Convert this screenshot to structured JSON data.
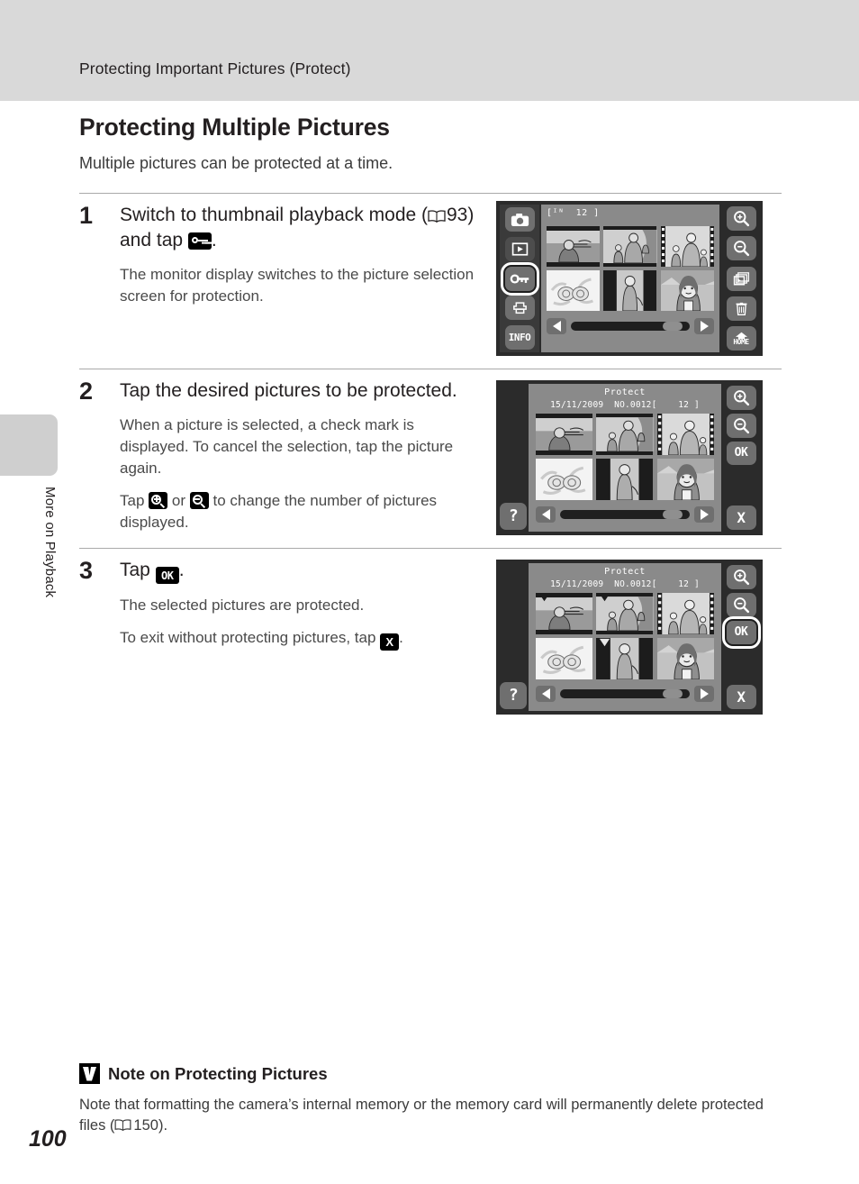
{
  "header": {
    "running_head": "Protecting Important Pictures (Protect)"
  },
  "sidebar": {
    "section_label": "More on Playback",
    "page_number": "100"
  },
  "section": {
    "title": "Protecting Multiple Pictures",
    "intro": "Multiple pictures can be protected at a time."
  },
  "steps": [
    {
      "number": "1",
      "head_part1": "Switch to thumbnail playback mode (",
      "head_ref": "93",
      "head_part2": ") and tap",
      "head_end": ".",
      "body": [
        "The monitor display switches to the picture selection screen for protection."
      ]
    },
    {
      "number": "2",
      "head": "Tap the desired pictures to be protected.",
      "body1": "When a picture is selected, a check mark is displayed. To cancel the selection, tap the picture again.",
      "body2_a": "Tap",
      "body2_b": "or",
      "body2_c": "to change the number of pictures displayed."
    },
    {
      "number": "3",
      "head_a": "Tap",
      "head_b": ".",
      "body1": "The selected pictures are protected.",
      "body2_a": "To exit without protecting pictures, tap",
      "body2_b": "."
    }
  ],
  "screens": {
    "screen1": {
      "counter": "[ᴵᴺ  12 ]",
      "left_buttons": [
        {
          "name": "camera-mode-button",
          "icon": "camera-icon",
          "selected": false
        },
        {
          "name": "playback-mode-button",
          "icon": "play-icon",
          "selected": false
        },
        {
          "name": "protect-button",
          "icon": "key-icon",
          "selected": true
        },
        {
          "name": "print-order-button",
          "icon": "printer-icon",
          "selected": false
        },
        {
          "name": "info-button",
          "icon": "info-icon",
          "label": "INFO",
          "selected": false
        }
      ],
      "right_buttons": [
        {
          "name": "zoom-in-button",
          "icon": "zoom-in-icon"
        },
        {
          "name": "zoom-out-button",
          "icon": "zoom-out-icon"
        },
        {
          "name": "slideshow-button",
          "icon": "frames-icon"
        },
        {
          "name": "delete-button",
          "icon": "trash-icon"
        },
        {
          "name": "home-button",
          "icon": "home-icon",
          "label": "HOME"
        }
      ],
      "scroll_left": "◀",
      "scroll_right": "▶"
    },
    "screen2": {
      "title": "Protect",
      "subline": "15/11/2009  NO.0012[    12 ]",
      "right_buttons": [
        {
          "name": "zoom-in-button",
          "icon": "zoom-in-icon"
        },
        {
          "name": "zoom-out-button",
          "icon": "zoom-out-icon"
        },
        {
          "name": "ok-button",
          "icon": "ok-icon",
          "label": "OK",
          "selected": false
        },
        {
          "name": "exit-button",
          "icon": "x-icon",
          "label": "X"
        }
      ],
      "help_button": "?",
      "checked": [
        false,
        false,
        false,
        false,
        false,
        false
      ]
    },
    "screen3": {
      "title": "Protect",
      "subline": "15/11/2009  NO.0012[    12 ]",
      "right_buttons": [
        {
          "name": "zoom-in-button",
          "icon": "zoom-in-icon"
        },
        {
          "name": "zoom-out-button",
          "icon": "zoom-out-icon"
        },
        {
          "name": "ok-button",
          "icon": "ok-icon",
          "label": "OK",
          "selected": true
        },
        {
          "name": "exit-button",
          "icon": "x-icon",
          "label": "X"
        }
      ],
      "help_button": "?",
      "checked": [
        true,
        true,
        false,
        false,
        true,
        false
      ]
    }
  },
  "note": {
    "title": "Note on Protecting Pictures",
    "text_a": "Note that formatting the camera’s internal memory or the memory card will permanently delete protected files (",
    "ref": "150",
    "text_b": ")."
  }
}
